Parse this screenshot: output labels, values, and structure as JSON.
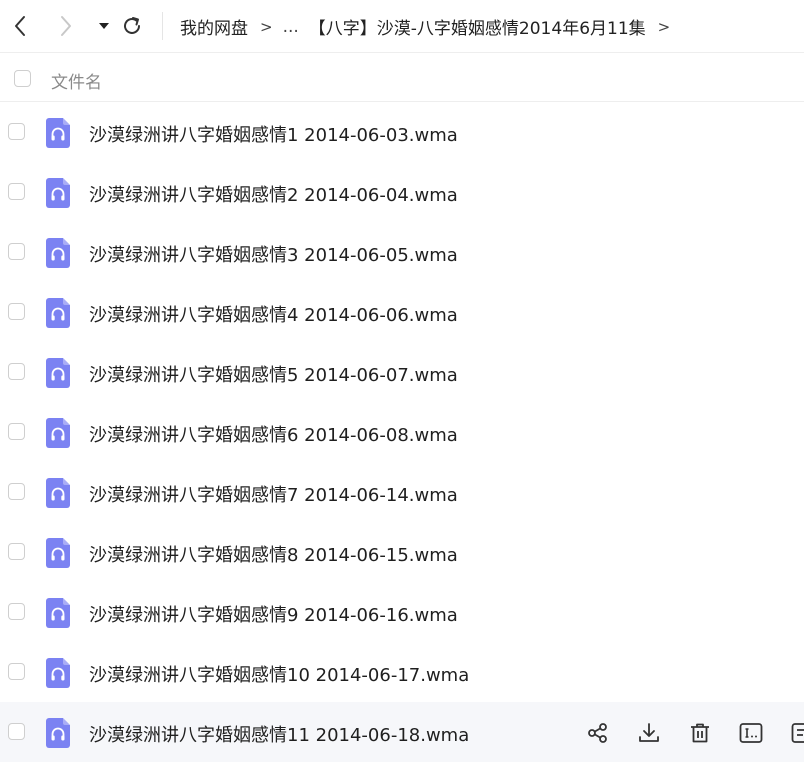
{
  "nav": {
    "back": "back-icon",
    "forward": "forward-icon",
    "history": "caret-down-icon",
    "refresh": "refresh-icon"
  },
  "breadcrumb": {
    "root": "我的网盘",
    "sep1": ">",
    "ellipsis": "...",
    "current": "【八字】沙漠-八字婚姻感情2014年6月11集",
    "sep2": ">"
  },
  "header": {
    "column_name": "文件名"
  },
  "files": [
    {
      "name": "沙漠绿洲讲八字婚姻感情1 2014-06-03.wma"
    },
    {
      "name": "沙漠绿洲讲八字婚姻感情2 2014-06-04.wma"
    },
    {
      "name": "沙漠绿洲讲八字婚姻感情3 2014-06-05.wma"
    },
    {
      "name": "沙漠绿洲讲八字婚姻感情4 2014-06-06.wma"
    },
    {
      "name": "沙漠绿洲讲八字婚姻感情5 2014-06-07.wma"
    },
    {
      "name": "沙漠绿洲讲八字婚姻感情6 2014-06-08.wma"
    },
    {
      "name": "沙漠绿洲讲八字婚姻感情7 2014-06-14.wma"
    },
    {
      "name": "沙漠绿洲讲八字婚姻感情8 2014-06-15.wma"
    },
    {
      "name": "沙漠绿洲讲八字婚姻感情9 2014-06-16.wma"
    },
    {
      "name": "沙漠绿洲讲八字婚姻感情10 2014-06-17.wma"
    },
    {
      "name": "沙漠绿洲讲八字婚姻感情11 2014-06-18.wma"
    }
  ],
  "row_actions": [
    "share-icon",
    "download-icon",
    "delete-icon",
    "rename-icon",
    "more-icon"
  ],
  "colors": {
    "audio_icon": "#7b82f2",
    "hover_row": "#f6f7fa"
  }
}
